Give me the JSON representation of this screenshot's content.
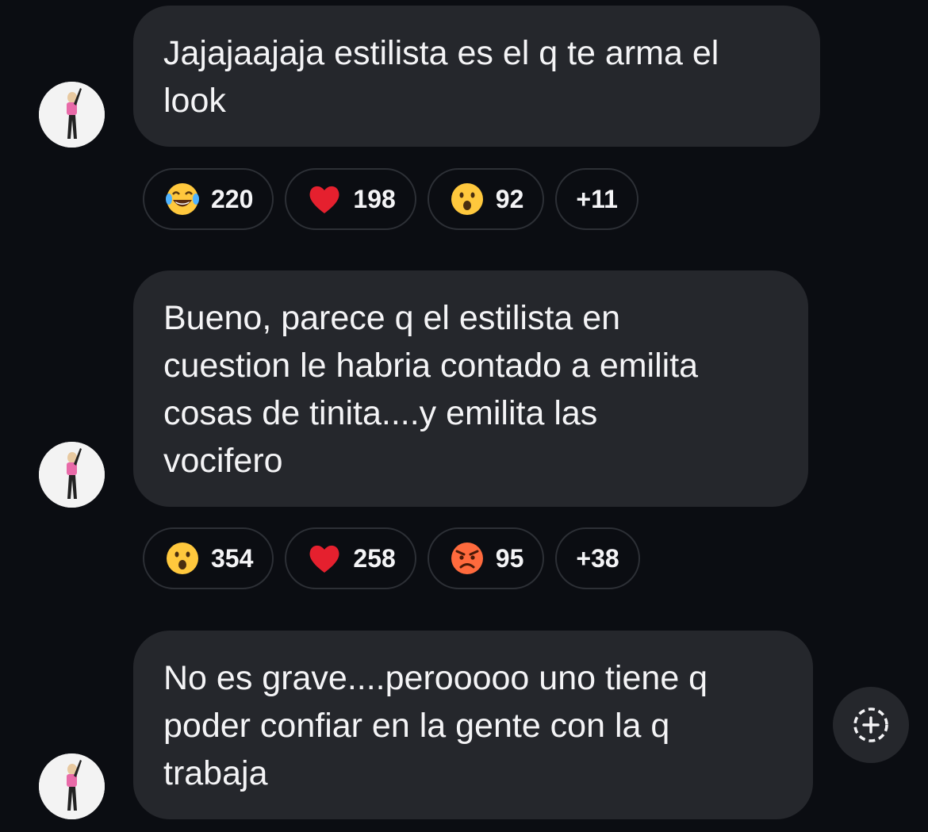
{
  "messages": [
    {
      "text": "Jajajaajaja estilista es el q te arma el\nlook",
      "reactions": [
        {
          "icon": "laughing-tears-emoji-icon",
          "count": "220"
        },
        {
          "icon": "red-heart-emoji-icon",
          "count": "198"
        },
        {
          "icon": "surprised-face-emoji-icon",
          "count": "92"
        }
      ],
      "more": "+11"
    },
    {
      "text": "Bueno, parece q el estilista en\ncuestion le habria contado a emilita\ncosas de tinita....y emilita las\nvocifero",
      "reactions": [
        {
          "icon": "surprised-face-emoji-icon",
          "count": "354"
        },
        {
          "icon": "red-heart-emoji-icon",
          "count": "258"
        },
        {
          "icon": "angry-face-emoji-icon",
          "count": "95"
        }
      ],
      "more": "+38"
    },
    {
      "text": "No es grave....perooooo uno tiene q\npoder confiar en la gente con la q\ntrabaja"
    }
  ],
  "colors": {
    "background": "#0b0d12",
    "bubble": "#25272c",
    "pill_border": "#2d3036",
    "text": "#f4f4f6"
  },
  "add_reaction_icon": "add-reaction-icon"
}
